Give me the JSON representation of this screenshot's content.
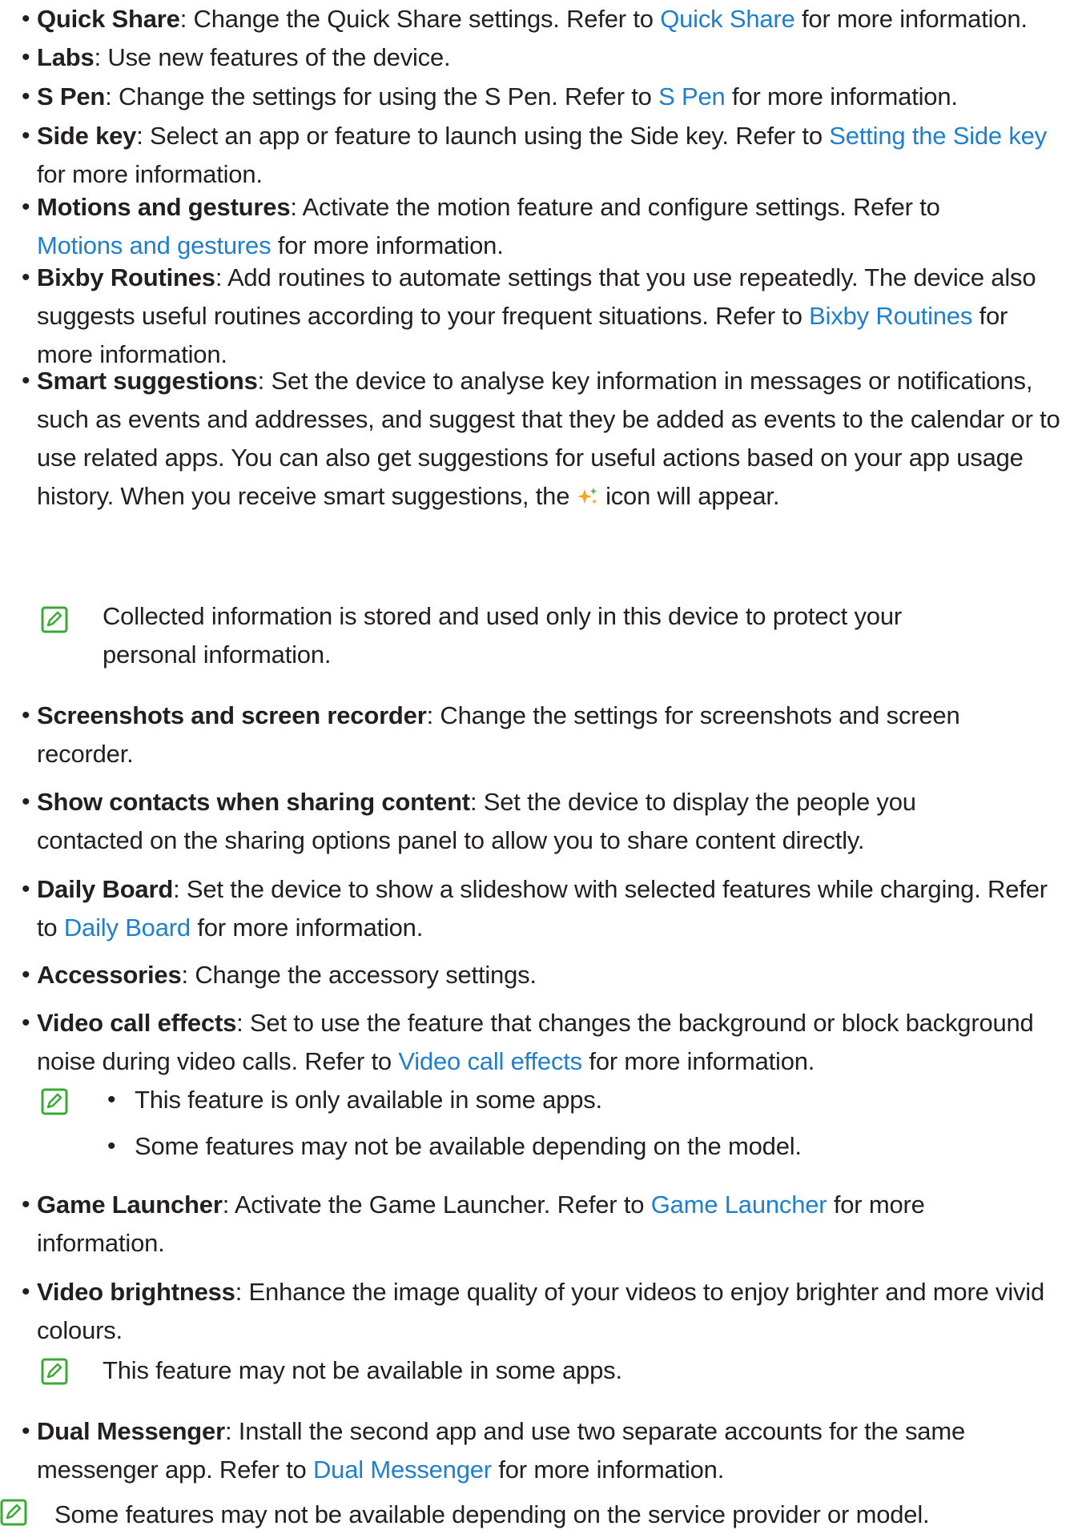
{
  "items": [
    {
      "title": "Quick Share",
      "desc": ": Change the Quick Share settings. Refer to ",
      "link": "Quick Share",
      "after": " for more information."
    },
    {
      "title": "Labs",
      "desc": ": Use new features of the device."
    },
    {
      "title": "S Pen",
      "desc": ": Change the settings for using the S Pen. Refer to ",
      "link": "S Pen",
      "after": " for more information."
    },
    {
      "title": "Side key",
      "desc": ": Select an app or feature to launch using the Side key. Refer to ",
      "link": "Setting the Side key",
      "after": " for more information."
    },
    {
      "title": "Motions and gestures",
      "desc": ": Activate the motion feature and configure settings. Refer to ",
      "link": "Motions and gestures",
      "after": " for more information."
    },
    {
      "title": "Bixby Routines",
      "desc": ": Add routines to automate settings that you use repeatedly. The device also suggests useful routines according to your frequent situations. Refer to ",
      "link": "Bixby Routines",
      "after": " for more information."
    },
    {
      "title": "Smart suggestions",
      "desc": ": Set the device to analyse key information in messages or notifications, such as events and addresses, and suggest that they be added as events to the calendar or to use related apps. You can also get suggestions for useful actions based on your app usage history. When you receive smart suggestions, the ",
      "after": " icon will appear."
    },
    {
      "title": "Screenshots and screen recorder",
      "desc": ": Change the settings for screenshots and screen recorder."
    },
    {
      "title": "Show contacts when sharing content",
      "desc": ": Set the device to display the people you contacted on the sharing options panel to allow you to share content directly."
    },
    {
      "title": "Daily Board",
      "desc": ": Set the device to show a slideshow with selected features while charging. Refer to ",
      "link": "Daily Board",
      "after": " for more information."
    },
    {
      "title": "Accessories",
      "desc": ": Change the accessory settings."
    },
    {
      "title": "Video call effects",
      "desc": ": Set to use the feature that changes the background or block background noise during video calls. Refer to ",
      "link": "Video call effects",
      "after": " for more information."
    },
    {
      "title": "Game Launcher",
      "desc": ": Activate the Game Launcher. Refer to ",
      "link": "Game Launcher",
      "after": " for more information."
    },
    {
      "title": "Video brightness",
      "desc": ": Enhance the image quality of your videos to enjoy brighter and more vivid colours."
    },
    {
      "title": "Dual Messenger",
      "desc": ": Install the second app and use two separate accounts for the same messenger app. Refer to ",
      "link": "Dual Messenger",
      "after": " for more information."
    }
  ],
  "notes": {
    "smart": "Collected information is stored and used only in this device to protect your personal information.",
    "video_call_1": "This feature is only available in some apps.",
    "video_call_2": "Some features may not be available depending on the model.",
    "video_brightness": "This feature may not be available in some apps.",
    "footer": "Some features may not be available depending on the service provider or model."
  },
  "colors": {
    "link": "#1f7fcf",
    "note_icon": "#3aaa35",
    "spark": "#f5a623"
  },
  "icons": {
    "note": "note-icon",
    "smart_suggestion": "sparkle-icon"
  }
}
